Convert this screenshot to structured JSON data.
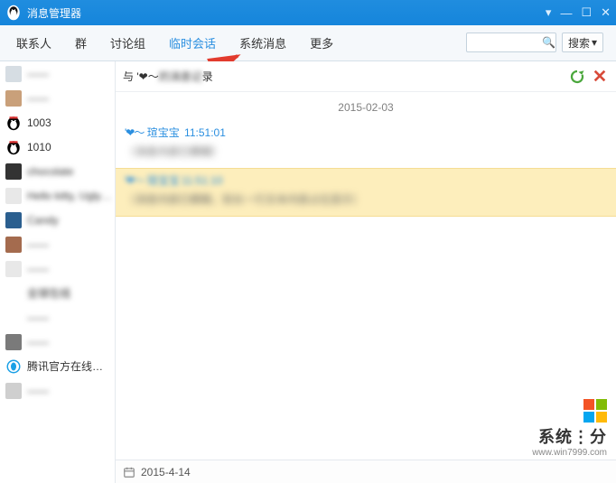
{
  "window": {
    "title": "消息管理器"
  },
  "tabs": {
    "items": [
      "联系人",
      "群",
      "讨论组",
      "临时会话",
      "系统消息",
      "更多"
    ],
    "active_index": 3
  },
  "search": {
    "placeholder": "",
    "button_label": "搜索",
    "button_caret": "▾"
  },
  "sidebar": {
    "items": [
      {
        "name": "——",
        "avatar_color": "#d6dde3",
        "clear": false
      },
      {
        "name": "——",
        "avatar_color": "#c9a07a",
        "clear": false
      },
      {
        "name": "1003",
        "avatar_color": "#000000",
        "clear": true,
        "penguin": true
      },
      {
        "name": "1010",
        "avatar_color": "#000000",
        "clear": true,
        "penguin": true
      },
      {
        "name": "chocolate",
        "avatar_color": "#333333",
        "clear": false
      },
      {
        "name": "Hello kitty, Ugly…",
        "avatar_color": "#e8e8e8",
        "clear": false
      },
      {
        "name": "Candy",
        "avatar_color": "#2b5f8f",
        "clear": false
      },
      {
        "name": "——",
        "avatar_color": "#a46b4e",
        "clear": false
      },
      {
        "name": "——",
        "avatar_color": "#e8e8e8",
        "clear": false
      },
      {
        "name": "全球在线",
        "avatar_color": "#ffffff",
        "clear": false
      },
      {
        "name": "——",
        "avatar_color": "#ffffff",
        "clear": false
      },
      {
        "name": "——",
        "avatar_color": "#7a7a7a",
        "clear": false
      },
      {
        "name": "腾讯官方在线…",
        "avatar_color": "#ffffff",
        "clear": true,
        "tencent": true
      },
      {
        "name": "——",
        "avatar_color": "#cfcfcf",
        "clear": false
      }
    ]
  },
  "chat": {
    "with_prefix": "与 ",
    "with_name": "'❤〜",
    "with_blur": "的消息记",
    "with_suffix": "录",
    "date": "2015-02-03",
    "messages": [
      {
        "prefix": "'❤〜",
        "speaker": "瑄宝宝",
        "time": "11:51:01",
        "body": "（消息内容已模糊）",
        "highlight": false
      },
      {
        "prefix": "'❤〜",
        "speaker": "瑄宝宝",
        "time": "11:51:10",
        "body": "（消息内容已模糊，较长一行文本内容占位显示）",
        "highlight": true
      }
    ]
  },
  "footer": {
    "date": "2015-4-14"
  },
  "watermark": {
    "text": "系统⋮分",
    "url": "www.win7999.com"
  }
}
